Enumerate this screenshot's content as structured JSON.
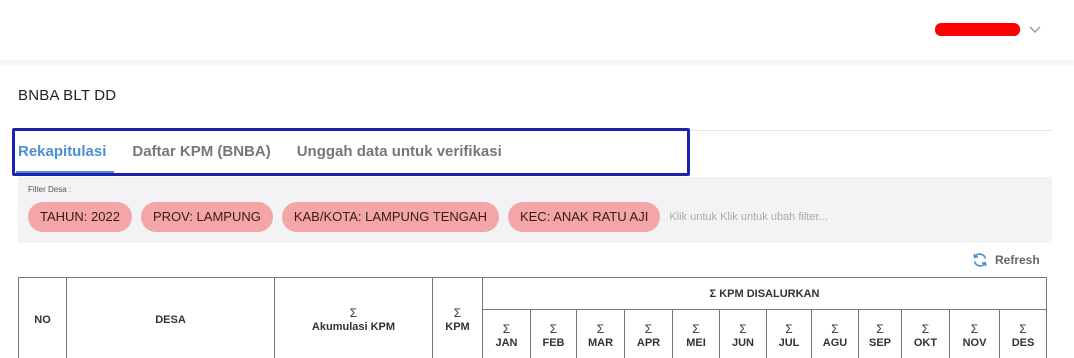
{
  "header": {
    "user_name_redacted": true,
    "redaction_color": "#ff0000",
    "chevron_icon": "chevron-down-icon"
  },
  "page": {
    "title": "BNBA BLT DD"
  },
  "tabs": [
    {
      "label": "Rekapitulasi",
      "active": true
    },
    {
      "label": "Daftar KPM (BNBA)",
      "active": false
    },
    {
      "label": "Unggah data untuk verifikasi",
      "active": false
    }
  ],
  "filter": {
    "label": "Filter Desa :",
    "chips": [
      "TAHUN: 2022",
      "PROV: LAMPUNG",
      "KAB/KOTA: LAMPUNG TENGAH",
      "KEC: ANAK RATU AJI"
    ],
    "hint": "Klik untuk Klik untuk ubah filter..."
  },
  "refresh": {
    "label": "Refresh",
    "icon": "refresh-icon"
  },
  "table": {
    "sigma": "Σ",
    "headers": {
      "no": "NO",
      "desa": "DESA",
      "akumulasi": "Akumulasi KPM",
      "kpm": "KPM",
      "disalurkan": "Σ KPM DISALURKAN"
    },
    "months": [
      "JAN",
      "FEB",
      "MAR",
      "APR",
      "MEI",
      "JUN",
      "JUL",
      "AGU",
      "SEP",
      "OKT",
      "NOV",
      "DES"
    ]
  },
  "colors": {
    "accent": "#4a8fd6",
    "chip_bg": "#f4a5a5",
    "highlight_border": "#1f1fb0"
  }
}
